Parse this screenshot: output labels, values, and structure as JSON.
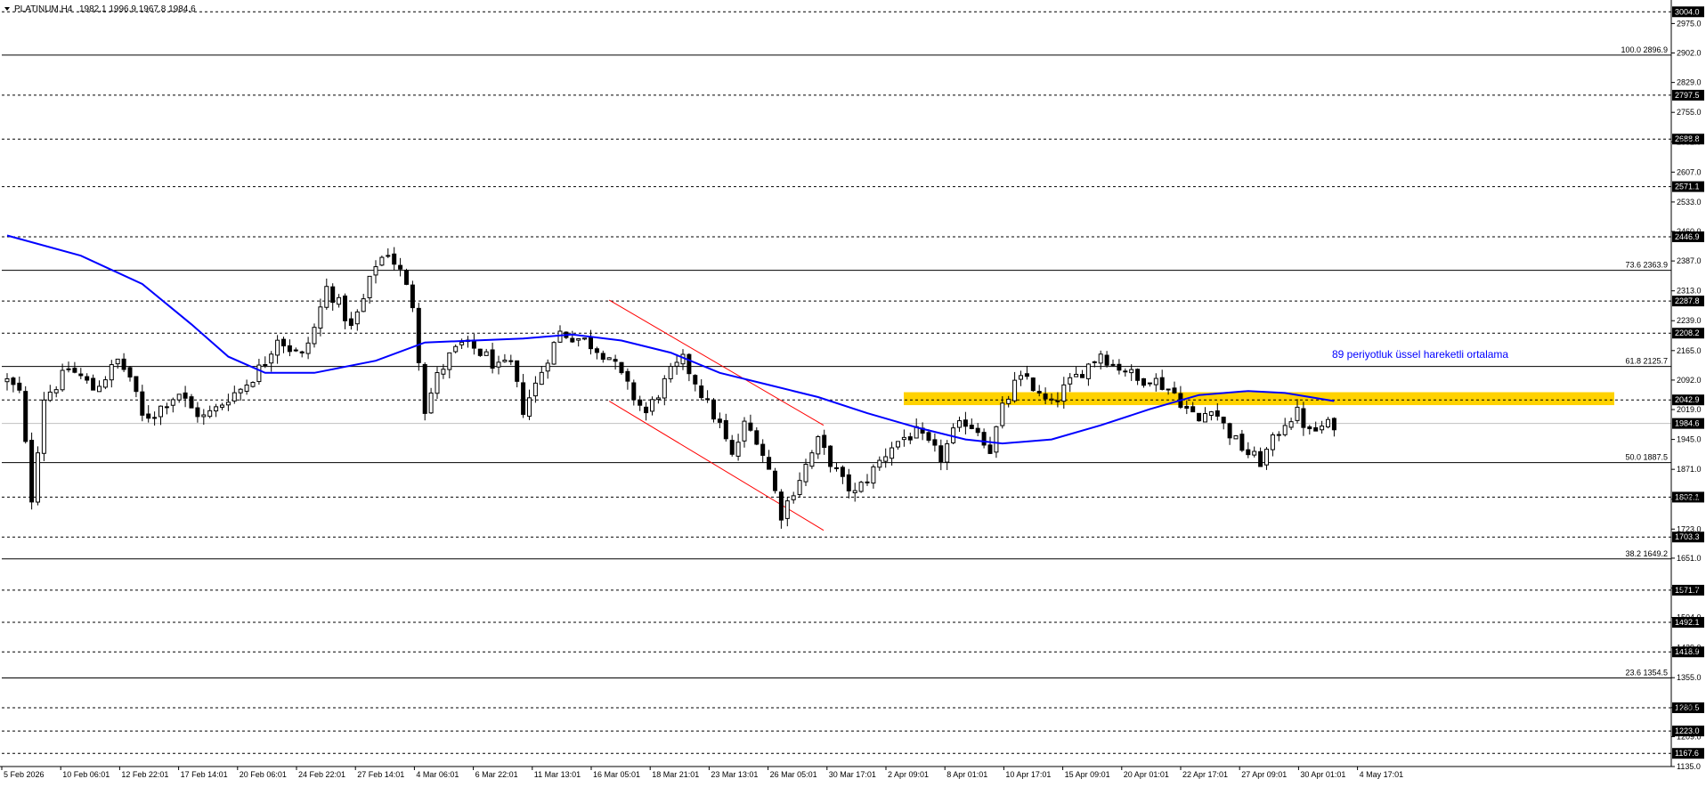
{
  "header": {
    "symbol": "PLATINUM,H4",
    "ohlc": "1982.1 1996.9 1967.8 1984.6",
    "menu_icon": "triangle-down-icon"
  },
  "colors": {
    "background": "#ffffff",
    "candle": "#000000",
    "grid": "#000000",
    "ema": "#0000ff",
    "zone": "#ffd200",
    "channel": "#ff0000",
    "annotation": "#0000ff",
    "current_price_line": "#c0c0c0"
  },
  "chart_data": {
    "type": "candlestick",
    "symbol": "PLATINUM",
    "timeframe": "H4",
    "ylim": [
      1135.0,
      3020.0
    ],
    "price_ticks": [
      "2975.0",
      "2902.0",
      "2829.0",
      "2755.0",
      "2682.0",
      "2607.0",
      "2533.0",
      "2460.0",
      "2387.0",
      "2313.0",
      "2239.0",
      "2165.0",
      "2092.0",
      "2019.0",
      "1945.0",
      "1871.0",
      "1797.0",
      "1723.0",
      "1651.0",
      "1577.0",
      "1504.0",
      "1429.0",
      "1355.0",
      "1281.0",
      "1209.0",
      "1135.0"
    ],
    "horizontal_levels": [
      {
        "value": 3004.0,
        "label": "3004.0",
        "style": "dashed"
      },
      {
        "value": 2797.5,
        "label": "2797.5",
        "style": "dashed"
      },
      {
        "value": 2688.8,
        "label": "2688.8",
        "style": "dashed"
      },
      {
        "value": 2571.1,
        "label": "2571.1",
        "style": "dashed"
      },
      {
        "value": 2446.9,
        "label": "2446.9",
        "style": "dashed"
      },
      {
        "value": 2287.8,
        "label": "2287.8",
        "style": "dashed"
      },
      {
        "value": 2208.2,
        "label": "2208.2",
        "style": "dashed"
      },
      {
        "value": 2042.9,
        "label": "2042.9",
        "style": "dashed"
      },
      {
        "value": 1802.1,
        "label": "1802.1",
        "style": "dashed"
      },
      {
        "value": 1703.3,
        "label": "1703.3",
        "style": "dashed"
      },
      {
        "value": 1571.7,
        "label": "1571.7",
        "style": "dashed"
      },
      {
        "value": 1492.1,
        "label": "1492.1",
        "style": "dashed"
      },
      {
        "value": 1418.9,
        "label": "1418.9",
        "style": "dashed"
      },
      {
        "value": 1280.5,
        "label": "1280.5",
        "style": "dashed"
      },
      {
        "value": 1223.0,
        "label": "1223.0",
        "style": "dashed"
      },
      {
        "value": 1167.6,
        "label": "1167.6",
        "style": "dashed"
      }
    ],
    "current_price": {
      "value": 1984.6,
      "label": "1984.6"
    },
    "fibonacci_levels": [
      {
        "value": 2896.9,
        "label": "100.0 2896.9"
      },
      {
        "value": 2363.9,
        "label": "73.6 2363.9"
      },
      {
        "value": 2125.7,
        "label": "61.8 2125.7"
      },
      {
        "value": 1887.5,
        "label": "50.0 1887.5"
      },
      {
        "value": 1649.2,
        "label": "38.2 1649.2"
      },
      {
        "value": 1354.5,
        "label": "23.6 1354.5"
      }
    ],
    "x_labels": [
      "5 Feb 2026",
      "10 Feb 06:01",
      "12 Feb 22:01",
      "17 Feb 14:01",
      "20 Feb 06:01",
      "24 Feb 22:01",
      "27 Feb 14:01",
      "4 Mar 06:01",
      "6 Mar 22:01",
      "11 Mar 13:01",
      "16 Mar 05:01",
      "18 Mar 21:01",
      "23 Mar 13:01",
      "26 Mar 05:01",
      "30 Mar 17:01",
      "2 Apr 09:01",
      "8 Apr 01:01",
      "10 Apr 17:01",
      "15 Apr 09:01",
      "20 Apr 01:01",
      "22 Apr 17:01",
      "27 Apr 09:01",
      "30 Apr 01:01",
      "4 May 17:01"
    ],
    "price_path": [
      [
        0,
        2090
      ],
      [
        1,
        2060
      ],
      [
        2,
        1800
      ],
      [
        3,
        2050
      ],
      [
        4,
        2080
      ],
      [
        5,
        2120
      ],
      [
        6,
        2100
      ],
      [
        7,
        2070
      ],
      [
        8,
        2100
      ],
      [
        9,
        2140
      ],
      [
        10,
        2100
      ],
      [
        11,
        2000
      ],
      [
        12,
        2010
      ],
      [
        13,
        2040
      ],
      [
        14,
        2060
      ],
      [
        15,
        2020
      ],
      [
        16,
        2000
      ],
      [
        17,
        2020
      ],
      [
        18,
        2050
      ],
      [
        19,
        2070
      ],
      [
        20,
        2100
      ],
      [
        21,
        2140
      ],
      [
        22,
        2200
      ],
      [
        23,
        2170
      ],
      [
        24,
        2150
      ],
      [
        25,
        2220
      ],
      [
        26,
        2320
      ],
      [
        27,
        2280
      ],
      [
        28,
        2220
      ],
      [
        29,
        2290
      ],
      [
        30,
        2380
      ],
      [
        31,
        2410
      ],
      [
        32,
        2360
      ],
      [
        33,
        2280
      ],
      [
        34,
        2020
      ],
      [
        35,
        2100
      ],
      [
        36,
        2150
      ],
      [
        37,
        2180
      ],
      [
        38,
        2170
      ],
      [
        39,
        2150
      ],
      [
        40,
        2120
      ],
      [
        41,
        2130
      ],
      [
        42,
        2020
      ],
      [
        43,
        2080
      ],
      [
        44,
        2150
      ],
      [
        45,
        2210
      ],
      [
        46,
        2200
      ],
      [
        47,
        2190
      ],
      [
        48,
        2170
      ],
      [
        49,
        2150
      ],
      [
        50,
        2100
      ],
      [
        51,
        2050
      ],
      [
        52,
        2010
      ],
      [
        53,
        2060
      ],
      [
        54,
        2110
      ],
      [
        55,
        2140
      ],
      [
        56,
        2090
      ],
      [
        57,
        2030
      ],
      [
        58,
        1980
      ],
      [
        59,
        1900
      ],
      [
        60,
        1980
      ],
      [
        61,
        1950
      ],
      [
        62,
        1870
      ],
      [
        63,
        1760
      ],
      [
        64,
        1820
      ],
      [
        65,
        1880
      ],
      [
        66,
        1940
      ],
      [
        67,
        1890
      ],
      [
        68,
        1840
      ],
      [
        69,
        1810
      ],
      [
        70,
        1850
      ],
      [
        71,
        1890
      ],
      [
        72,
        1930
      ],
      [
        73,
        1950
      ],
      [
        74,
        1960
      ],
      [
        75,
        1930
      ],
      [
        76,
        1900
      ],
      [
        77,
        1960
      ],
      [
        78,
        1990
      ],
      [
        79,
        1970
      ],
      [
        80,
        1920
      ],
      [
        81,
        2020
      ],
      [
        82,
        2080
      ],
      [
        83,
        2100
      ],
      [
        84,
        2050
      ],
      [
        85,
        2030
      ],
      [
        86,
        2070
      ],
      [
        87,
        2100
      ],
      [
        88,
        2130
      ],
      [
        89,
        2160
      ],
      [
        90,
        2130
      ],
      [
        91,
        2120
      ],
      [
        92,
        2090
      ],
      [
        93,
        2100
      ],
      [
        94,
        2080
      ],
      [
        95,
        2060
      ],
      [
        96,
        2020
      ],
      [
        97,
        1990
      ],
      [
        98,
        2030
      ],
      [
        99,
        1980
      ],
      [
        100,
        1940
      ],
      [
        101,
        1910
      ],
      [
        102,
        1890
      ],
      [
        103,
        1940
      ],
      [
        104,
        1990
      ],
      [
        105,
        2010
      ],
      [
        106,
        1960
      ],
      [
        107,
        1975
      ],
      [
        108,
        1984.6
      ]
    ],
    "ema_89": {
      "name": "89 periyotluk üssel hareketli ortalama",
      "path": [
        [
          0,
          2450
        ],
        [
          6,
          2400
        ],
        [
          11,
          2330
        ],
        [
          15,
          2230
        ],
        [
          18,
          2150
        ],
        [
          21,
          2110
        ],
        [
          25,
          2110
        ],
        [
          30,
          2140
        ],
        [
          34,
          2185
        ],
        [
          38,
          2190
        ],
        [
          42,
          2195
        ],
        [
          46,
          2205
        ],
        [
          50,
          2190
        ],
        [
          54,
          2160
        ],
        [
          58,
          2110
        ],
        [
          62,
          2080
        ],
        [
          66,
          2050
        ],
        [
          70,
          2010
        ],
        [
          74,
          1975
        ],
        [
          78,
          1945
        ],
        [
          81,
          1935
        ],
        [
          85,
          1945
        ],
        [
          89,
          1980
        ],
        [
          93,
          2020
        ],
        [
          97,
          2055
        ],
        [
          101,
          2065
        ],
        [
          104,
          2060
        ],
        [
          108,
          2040
        ]
      ]
    },
    "supply_zone": {
      "from": 2030.0,
      "to": 2062.0
    },
    "descending_channel": [
      {
        "from": [
          49,
          2290
        ],
        "to": [
          65,
          1980
        ]
      },
      {
        "from": [
          49,
          2040
        ],
        "to": [
          65,
          1720
        ]
      }
    ],
    "annotation": "89 periyotluk üssel hareketli ortalama"
  }
}
